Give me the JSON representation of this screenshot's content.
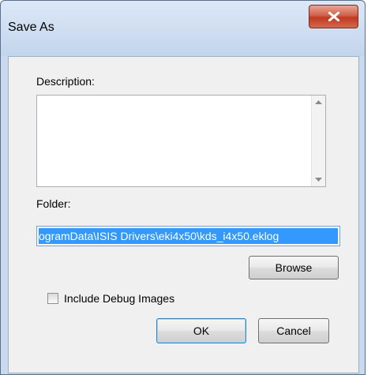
{
  "window": {
    "title": "Save As",
    "close_label": "Close"
  },
  "form": {
    "description_label": "Description:",
    "description_value": "",
    "folder_label": "Folder:",
    "folder_value": "ogramData\\ISIS Drivers\\eki4x50\\kds_i4x50.eklog",
    "browse_label": "Browse",
    "include_debug_label": "Include Debug Images",
    "include_debug_checked": false
  },
  "buttons": {
    "ok_label": "OK",
    "cancel_label": "Cancel"
  },
  "icons": {
    "close": "close-x-icon",
    "scroll_up": "scroll-up-arrow-icon",
    "scroll_down": "scroll-down-arrow-icon"
  }
}
